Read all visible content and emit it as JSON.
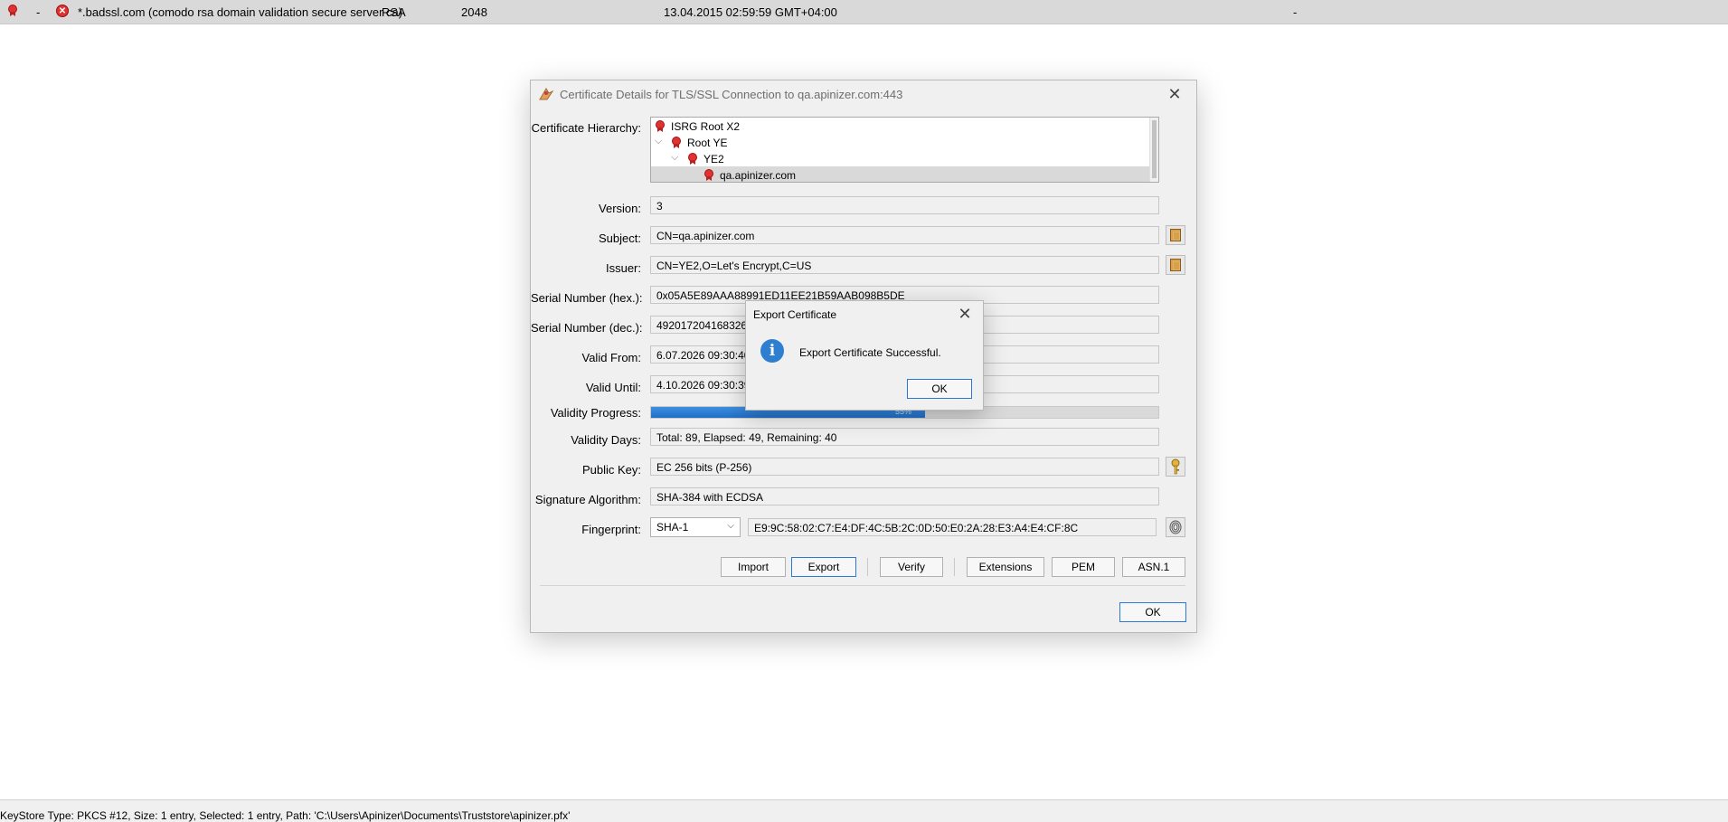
{
  "background_row": {
    "dash": "-",
    "alias": "*.badssl.com (comodo rsa domain validation secure server ca)",
    "algorithm": "RSA",
    "key_size": "2048",
    "expiry": "13.04.2015 02:59:59 GMT+04:00",
    "trailing": "-"
  },
  "status_bar": {
    "text": "KeyStore Type: PKCS #12, Size: 1 entry, Selected: 1 entry, Path: 'C:\\Users\\Apinizer\\Documents\\Truststore\\apinizer.pfx'"
  },
  "cert_dialog": {
    "title": "Certificate Details for TLS/SSL Connection to qa.apinizer.com:443",
    "labels": {
      "hierarchy": "Certificate Hierarchy:",
      "version": "Version:",
      "subject": "Subject:",
      "issuer": "Issuer:",
      "serial_hex": "Serial Number (hex.):",
      "serial_dec": "Serial Number (dec.):",
      "valid_from": "Valid From:",
      "valid_until": "Valid Until:",
      "validity_progress": "Validity Progress:",
      "validity_days": "Validity Days:",
      "public_key": "Public Key:",
      "signature_algorithm": "Signature Algorithm:",
      "fingerprint": "Fingerprint:"
    },
    "hierarchy": [
      {
        "label": "ISRG Root X2"
      },
      {
        "label": "Root YE"
      },
      {
        "label": "YE2"
      },
      {
        "label": "qa.apinizer.com"
      }
    ],
    "values": {
      "version": "3",
      "subject": "CN=qa.apinizer.com",
      "issuer": "CN=YE2,O=Let's Encrypt,C=US",
      "serial_hex": "0x05A5E89AAA88991ED11EE21B59AAB098B5DE",
      "serial_dec": "4920172041683264",
      "valid_from": "6.07.2026 09:30:40",
      "valid_until": "4.10.2026 09:30:39",
      "validity_progress_pct": 54,
      "validity_progress_text": "55%",
      "validity_days": "Total: 89, Elapsed: 49, Remaining: 40",
      "public_key": "EC 256 bits (P-256)",
      "signature_algorithm": "SHA-384 with ECDSA",
      "fingerprint_algorithm": "SHA-1",
      "fingerprint": "E9:9C:58:02:C7:E4:DF:4C:5B:2C:0D:50:E0:2A:28:E3:A4:E4:CF:8C"
    },
    "buttons": {
      "import": "Import",
      "export": "Export",
      "verify": "Verify",
      "extensions": "Extensions",
      "pem": "PEM",
      "asn1": "ASN.1",
      "ok": "OK"
    }
  },
  "export_dialog": {
    "title": "Export Certificate",
    "message": "Export Certificate Successful.",
    "ok": "OK"
  },
  "colors": {
    "progress": "#1f6fc9",
    "default_button_border": "#2b78d6",
    "ribbon": "#d33333"
  }
}
